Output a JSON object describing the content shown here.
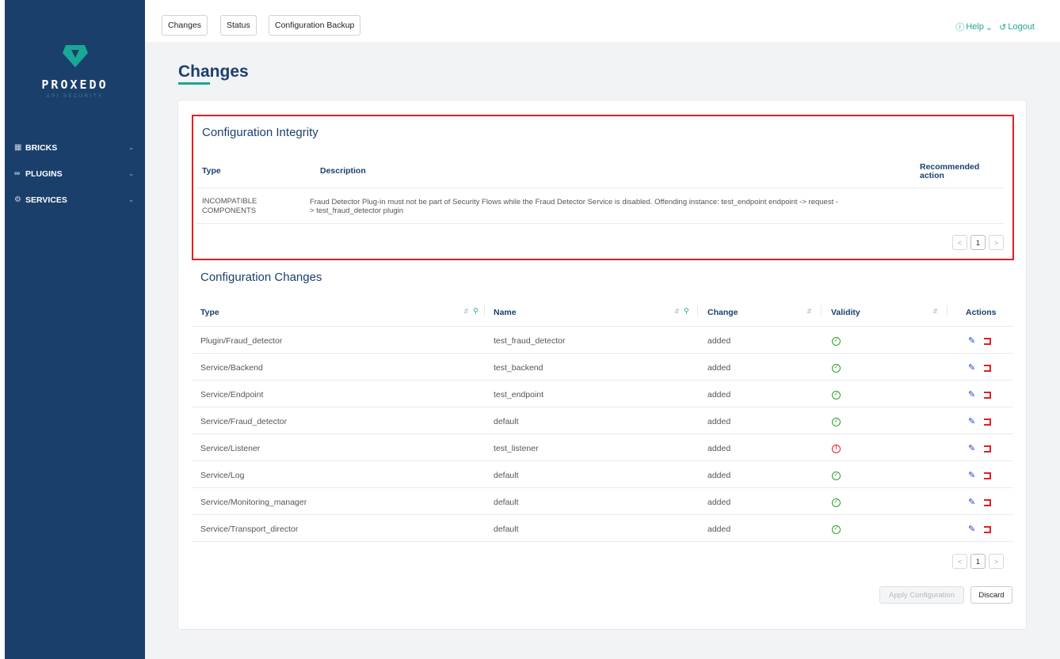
{
  "brand": {
    "name": "PROXEDO",
    "tagline": "API SECURITY"
  },
  "sidebar": {
    "items": [
      {
        "icon": "grid-icon",
        "label": "BRICKS"
      },
      {
        "icon": "plug-icon",
        "label": "PLUGINS"
      },
      {
        "icon": "gear-icon",
        "label": "SERVICES"
      }
    ]
  },
  "topbar": {
    "tabs": [
      "Changes",
      "Status",
      "Configuration Backup"
    ],
    "help": "Help",
    "logout": "Logout"
  },
  "page": {
    "title": "Changes"
  },
  "integrity": {
    "title": "Configuration Integrity",
    "columns": [
      "Type",
      "Description",
      "Recommended action"
    ],
    "rows": [
      {
        "type": "INCOMPATIBLE COMPONENTS",
        "description_line1": "Fraud Detector Plug-in must not be part of Security Flows while the Fraud Detector Service is disabled. Offending instance: test_endpoint endpoint -> request -",
        "description_line2": "> test_fraud_detector plugin",
        "action": ""
      }
    ],
    "page": "1"
  },
  "changes": {
    "title": "Configuration Changes",
    "columns": [
      "Type",
      "Name",
      "Change",
      "Validity",
      "Actions"
    ],
    "rows": [
      {
        "type": "Plugin/Fraud_detector",
        "name": "test_fraud_detector",
        "change": "added",
        "valid": true
      },
      {
        "type": "Service/Backend",
        "name": "test_backend",
        "change": "added",
        "valid": true
      },
      {
        "type": "Service/Endpoint",
        "name": "test_endpoint",
        "change": "added",
        "valid": true
      },
      {
        "type": "Service/Fraud_detector",
        "name": "default",
        "change": "added",
        "valid": true
      },
      {
        "type": "Service/Listener",
        "name": "test_listener",
        "change": "added",
        "valid": false
      },
      {
        "type": "Service/Log",
        "name": "default",
        "change": "added",
        "valid": true
      },
      {
        "type": "Service/Monitoring_manager",
        "name": "default",
        "change": "added",
        "valid": true
      },
      {
        "type": "Service/Transport_director",
        "name": "default",
        "change": "added",
        "valid": true
      }
    ],
    "page": "1"
  },
  "buttons": {
    "apply": "Apply Configuration",
    "discard": "Discard"
  },
  "colors": {
    "sidebar": "#1a3f6b",
    "accent": "#1fa79b",
    "highlight": "#e31e24",
    "valid": "#2ca02c"
  }
}
